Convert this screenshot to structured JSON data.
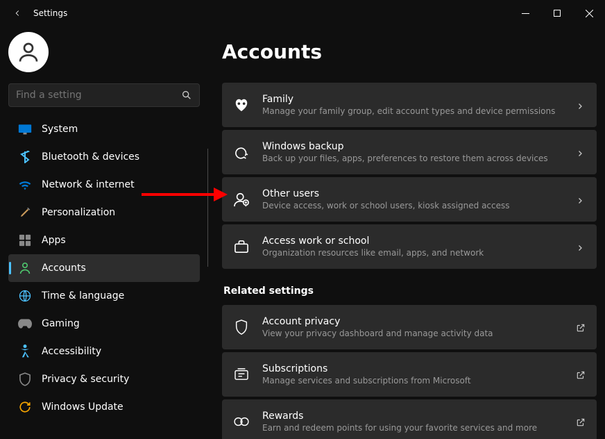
{
  "window": {
    "title": "Settings"
  },
  "search": {
    "placeholder": "Find a setting"
  },
  "sidebar": {
    "items": [
      {
        "label": "System"
      },
      {
        "label": "Bluetooth & devices"
      },
      {
        "label": "Network & internet"
      },
      {
        "label": "Personalization"
      },
      {
        "label": "Apps"
      },
      {
        "label": "Accounts"
      },
      {
        "label": "Time & language"
      },
      {
        "label": "Gaming"
      },
      {
        "label": "Accessibility"
      },
      {
        "label": "Privacy & security"
      },
      {
        "label": "Windows Update"
      }
    ]
  },
  "page": {
    "heading": "Accounts",
    "cards": [
      {
        "title": "Family",
        "sub": "Manage your family group, edit account types and device permissions"
      },
      {
        "title": "Windows backup",
        "sub": "Back up your files, apps, preferences to restore them across devices"
      },
      {
        "title": "Other users",
        "sub": "Device access, work or school users, kiosk assigned access"
      },
      {
        "title": "Access work or school",
        "sub": "Organization resources like email, apps, and network"
      }
    ],
    "related_heading": "Related settings",
    "related": [
      {
        "title": "Account privacy",
        "sub": "View your privacy dashboard and manage activity data"
      },
      {
        "title": "Subscriptions",
        "sub": "Manage services and subscriptions from Microsoft"
      },
      {
        "title": "Rewards",
        "sub": "Earn and redeem points for using your favorite services and more"
      }
    ]
  }
}
